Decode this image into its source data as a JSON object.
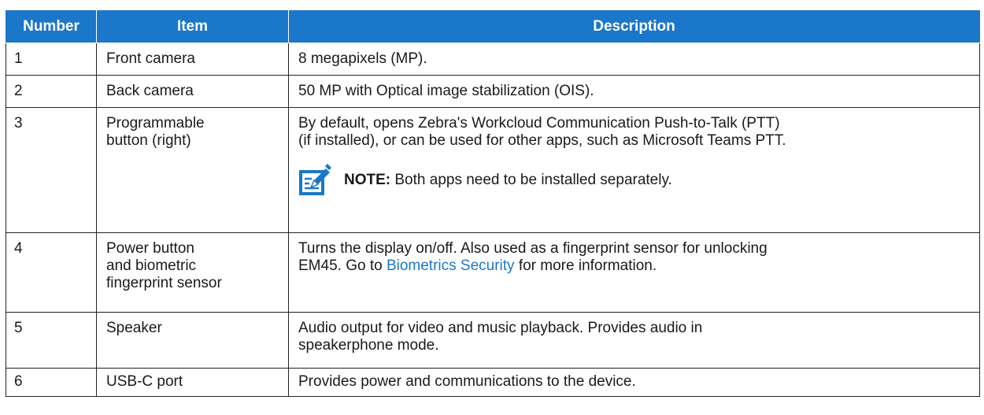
{
  "table": {
    "headers": [
      "Number",
      "Item",
      "Description"
    ],
    "rows": [
      {
        "number": "1",
        "item": "Front camera",
        "description": "8 megapixels (MP)."
      },
      {
        "number": "2",
        "item": "Back camera",
        "description": "50 MP with Optical image stabilization (OIS)."
      },
      {
        "number": "3",
        "item_line1": "Programmable",
        "item_line2": "button (right)",
        "description_line1": "By default, opens Zebra's Workcloud Communication Push-to-Talk (PTT)",
        "description_line2": "(if installed), or can be used for other apps, such as Microsoft Teams PTT.",
        "note_label": "NOTE:",
        "note_text": " Both apps need to be installed separately.",
        "note_icon": "note-edit-icon"
      },
      {
        "number": "4",
        "item_line1": "Power button",
        "item_line2": "and biometric",
        "item_line3": "fingerprint sensor",
        "description_line1": "Turns the display on/off. Also used as a fingerprint sensor for unlocking",
        "description_line2_pre": "EM45. Go to ",
        "description_link": "Biometrics Security",
        "description_line2_post": " for more information."
      },
      {
        "number": "5",
        "item": "Speaker",
        "description_line1": "Audio output for video and music playback. Provides audio in",
        "description_line2": "speakerphone mode."
      },
      {
        "number": "6",
        "item": "USB-C port",
        "description": "Provides power and communications to the device."
      }
    ]
  },
  "colors": {
    "header_bg": "#1a77c9",
    "link": "#1a77c9",
    "note_icon": "#1a77c9"
  }
}
